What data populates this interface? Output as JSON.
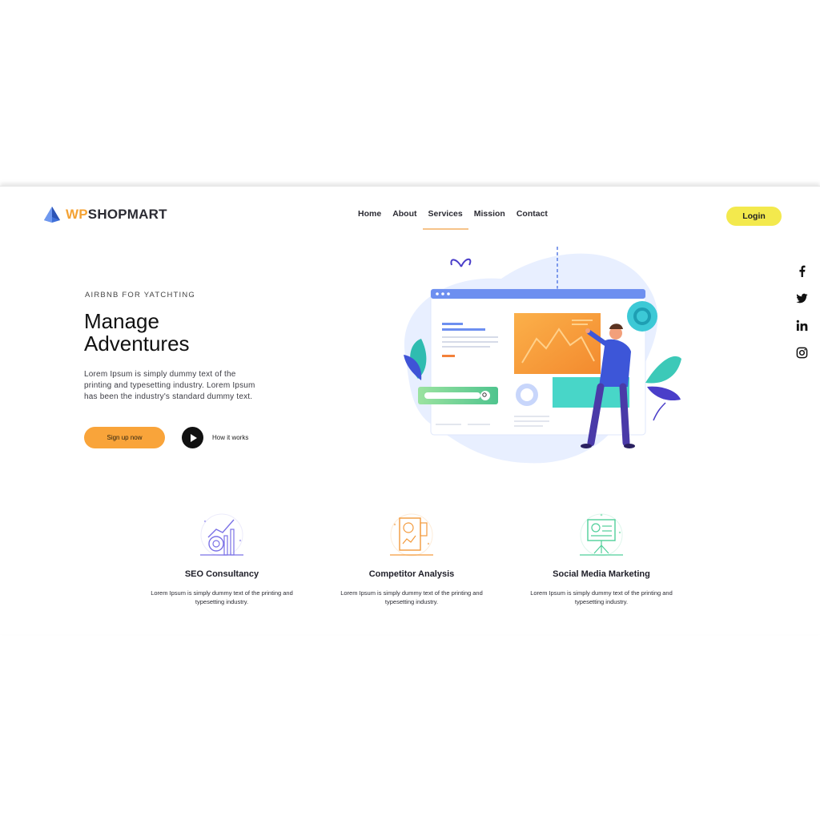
{
  "brand": {
    "wp": "WP",
    "rest": "SHOPMART"
  },
  "nav": {
    "items": [
      {
        "label": "Home"
      },
      {
        "label": "About"
      },
      {
        "label": "Services"
      },
      {
        "label": "Mission"
      },
      {
        "label": "Contact"
      }
    ],
    "active": "Services"
  },
  "header": {
    "login_label": "Login"
  },
  "social": [
    "facebook-icon",
    "twitter-icon",
    "linkedin-icon",
    "instagram-icon"
  ],
  "hero": {
    "eyebrow": "AIRBNB FOR YATCHTING",
    "title_line1": "Manage",
    "title_line2": "Adventures",
    "description": "Lorem Ipsum is simply dummy text of the printing and typesetting industry. Lorem Ipsum has been the industry's standard dummy text.",
    "signup_label": "Sign up now",
    "how_label": "How it works"
  },
  "features": [
    {
      "title": "SEO Consultancy",
      "description": "Lorem Ipsum is simply dummy text of the printing and typesetting industry.",
      "icon": "seo-chart-icon",
      "color": "#7b72e6"
    },
    {
      "title": "Competitor Analysis",
      "description": "Lorem Ipsum is simply dummy text of the printing and typesetting industry.",
      "icon": "analysis-report-icon",
      "color": "#f39a3c"
    },
    {
      "title": "Social Media Marketing",
      "description": "Lorem Ipsum is simply dummy text of the printing and typesetting industry.",
      "icon": "presentation-board-icon",
      "color": "#4fcf9a"
    }
  ],
  "colors": {
    "accent_orange": "#f9a43a",
    "login_yellow": "#f3e94d",
    "logo_blue": "#3f6fd8"
  }
}
